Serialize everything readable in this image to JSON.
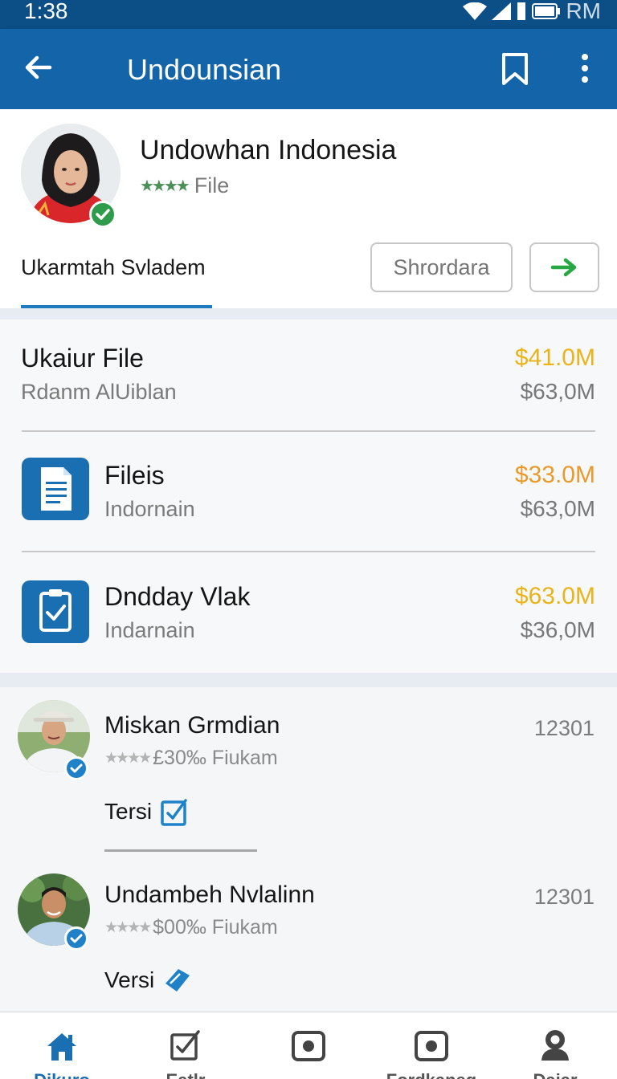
{
  "status_bar": {
    "time": "1:38",
    "label": "RM"
  },
  "app_bar": {
    "title": "Undounsian",
    "icons": [
      "back-arrow-icon",
      "bookmark-icon",
      "more-vert-icon"
    ]
  },
  "profile": {
    "name": "Undowhan Indonesia",
    "subtitle": "File",
    "rating": "★★★★",
    "tab_label": "Ukarmtah Svladem",
    "button_label": "Shrordara"
  },
  "files": [
    {
      "title": "Ukaiur File",
      "subtitle": "Rdanm AlUiblan",
      "amount_primary": "$41.0M",
      "amount_secondary": "$63,0M",
      "primary_color": "#e9b31a"
    },
    {
      "title": "Fileis",
      "subtitle": "Indornain",
      "amount_primary": "$33.0M",
      "amount_secondary": "$63,0M",
      "primary_color": "#ea9a2c",
      "icon": "document-icon"
    },
    {
      "title": "Dndday Vlak",
      "subtitle": "Indarnain",
      "amount_primary": "$63.0M",
      "amount_secondary": "$36,0M",
      "primary_color": "#e9b31a",
      "icon": "clipboard-check-icon"
    }
  ],
  "people": [
    {
      "name": "Miskan Grmdian",
      "rating": "★★★★",
      "meta": "£30‰ Fiukam",
      "count": "12301",
      "action": "Tersi"
    },
    {
      "name": "Undambeh Nvlalinn",
      "rating": "★★★★",
      "meta": "$00‰ Fiukam",
      "count": "12301",
      "action": "Versi"
    }
  ],
  "bottom_nav": [
    {
      "label": "Dikuro",
      "icon": "home-icon",
      "active": true
    },
    {
      "label": "Eatlr",
      "icon": "edit-checklist-icon",
      "active": false
    },
    {
      "label": "",
      "icon": "record-icon",
      "active": false
    },
    {
      "label": "Fordkaneg",
      "icon": "record-icon",
      "active": false
    },
    {
      "label": "Daiar",
      "icon": "person-icon",
      "active": false
    }
  ],
  "colors": {
    "appbar": "#1364a8",
    "statusbar": "#0c4f86",
    "accent": "#1f7bc0",
    "verified": "#2e9c4b"
  }
}
